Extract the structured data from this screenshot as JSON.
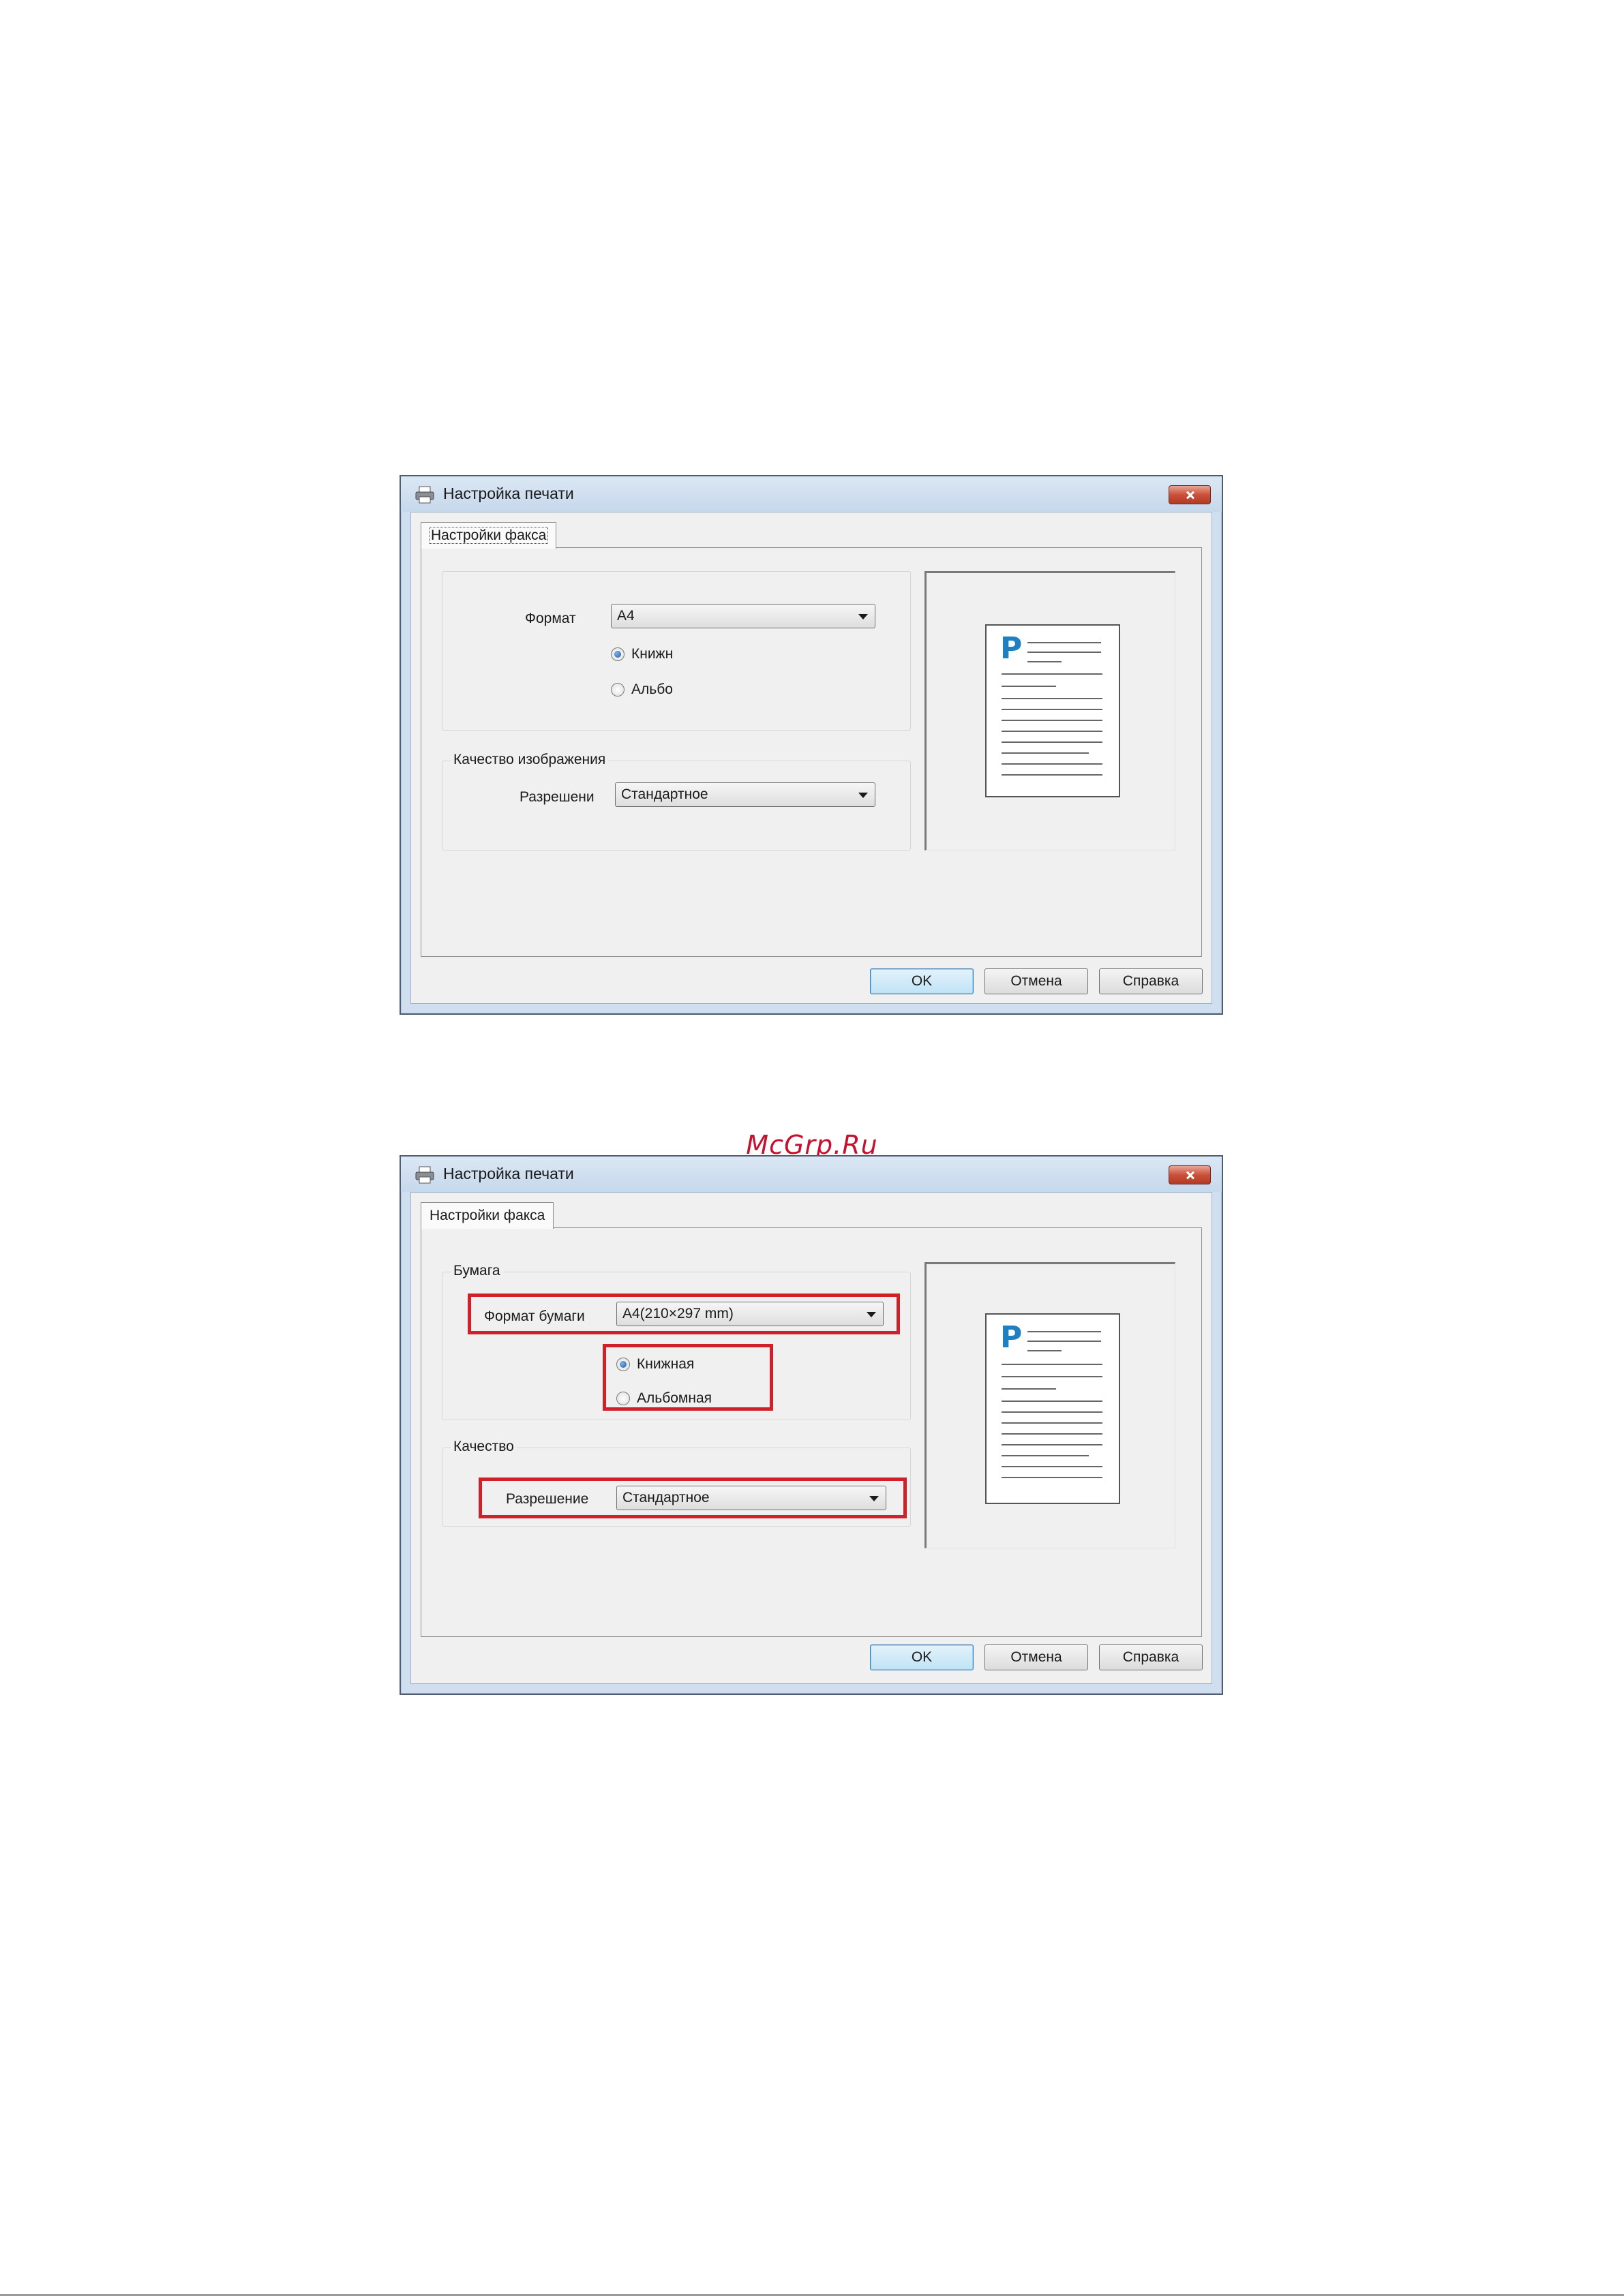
{
  "watermark": "McGrp.Ru",
  "dialog1": {
    "title": "Настройка печати",
    "tab": "Настройки факса",
    "format_label": "Формат",
    "format_value": "A4",
    "radio_portrait": "Книжн",
    "radio_landscape": "Альбо",
    "quality_group": "Качество изображения",
    "resolution_label": "Разрешени",
    "resolution_value": "Стандартное",
    "ok": "OK",
    "cancel": "Отмена",
    "help": "Справка"
  },
  "dialog2": {
    "title": "Настройка печати",
    "tab": "Настройки факса",
    "paper_group": "Бумага",
    "paper_format_label": "Формат бумаги",
    "paper_format_value": "A4(210×297 mm)",
    "radio_portrait": "Книжная",
    "radio_landscape": "Альбомная",
    "quality_group": "Качество",
    "resolution_label": "Разрешение",
    "resolution_value": "Стандартное",
    "ok": "OK",
    "cancel": "Отмена",
    "help": "Справка"
  },
  "colors": {
    "highlight": "#d0202a",
    "accent_blue": "#1e7fc1"
  },
  "icons": {
    "title_icon": "printer-icon",
    "close_icon": "close-icon"
  }
}
